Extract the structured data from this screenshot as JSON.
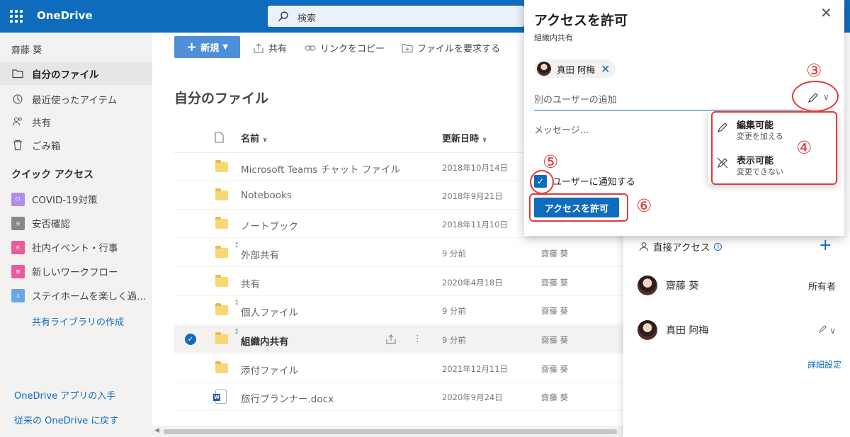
{
  "app": {
    "name": "OneDrive"
  },
  "search": {
    "placeholder": "検索"
  },
  "sidebar": {
    "user": "齋藤 葵",
    "nav": [
      {
        "label": "自分のファイル",
        "icon": "folder-icon",
        "active": true
      },
      {
        "label": "最近使ったアイテム",
        "icon": "recent-icon"
      },
      {
        "label": "共有",
        "icon": "shared-icon"
      },
      {
        "label": "ごみ箱",
        "icon": "recycle-bin-icon"
      }
    ],
    "quick_access_title": "クイック アクセス",
    "quick_access": [
      {
        "label": "COVID-19対策",
        "badge": "C1",
        "color": "#b38cf0"
      },
      {
        "label": "安否確認",
        "badge": "安",
        "color": "#8a8886"
      },
      {
        "label": "社内イベント・行事",
        "badge": "社",
        "color": "#e85c9c"
      },
      {
        "label": "新しいワークフロー",
        "badge": "新",
        "color": "#e85c9c"
      },
      {
        "label": "ステイホームを楽しく過...",
        "badge": "ス",
        "color": "#6aa6e8"
      }
    ],
    "create_library": "共有ライブラリの作成",
    "get_apps": "OneDrive アプリの入手",
    "classic": "従来の OneDrive に戻す"
  },
  "toolbar": {
    "new": "新規",
    "share": "共有",
    "copy_link": "リンクをコピー",
    "request_files": "ファイルを要求する"
  },
  "main": {
    "title": "自分のファイル",
    "columns": {
      "name": "名前",
      "modified": "更新日時"
    },
    "rows": [
      {
        "name": "Microsoft Teams チャット ファイル",
        "date": "2018年10月14日",
        "by": "",
        "shared": false
      },
      {
        "name": "Notebooks",
        "date": "2018年9月21日",
        "by": "",
        "shared": false
      },
      {
        "name": "ノートブック",
        "date": "2018年11月10日",
        "by": "",
        "shared": false
      },
      {
        "name": "外部共有",
        "date": "9 分前",
        "by": "齋藤 葵",
        "shared": true
      },
      {
        "name": "共有",
        "date": "2020年4月18日",
        "by": "齋藤 葵",
        "shared": false
      },
      {
        "name": "個人ファイル",
        "date": "9 分前",
        "by": "齋藤 葵",
        "shared": true
      },
      {
        "name": "組織内共有",
        "date": "9 分前",
        "by": "齋藤 葵",
        "shared": true,
        "selected": true
      },
      {
        "name": "添付ファイル",
        "date": "2021年12月11日",
        "by": "齋藤 葵",
        "shared": false
      },
      {
        "name": "旅行プランナー.docx",
        "date": "2020年9月24日",
        "by": "齋藤 葵",
        "shared": false,
        "type": "word"
      }
    ]
  },
  "access_panel": {
    "direct_access": "直接アクセス",
    "people": [
      {
        "name": "齋藤 葵",
        "role": "所有者"
      },
      {
        "name": "真田 阿梅",
        "role": ""
      }
    ],
    "advanced": "詳細設定"
  },
  "dialog": {
    "title": "アクセスを許可",
    "subtitle": "組織内共有",
    "chip_name": "真田 阿梅",
    "add_user_placeholder": "別のユーザーの追加",
    "message_placeholder": "メッセージ...",
    "notify_label": "ユーザーに通知する",
    "grant_button": "アクセスを許可"
  },
  "permission_menu": [
    {
      "label": "編集可能",
      "desc": "変更を加える",
      "icon": "pencil-icon"
    },
    {
      "label": "表示可能",
      "desc": "変更できない",
      "icon": "no-edit-icon"
    }
  ],
  "annotations": {
    "s3": "③",
    "s4": "④",
    "s5": "⑤",
    "s6": "⑥"
  },
  "colors": {
    "accent": "#0f6cbd",
    "annotation": "#e23a3a"
  }
}
